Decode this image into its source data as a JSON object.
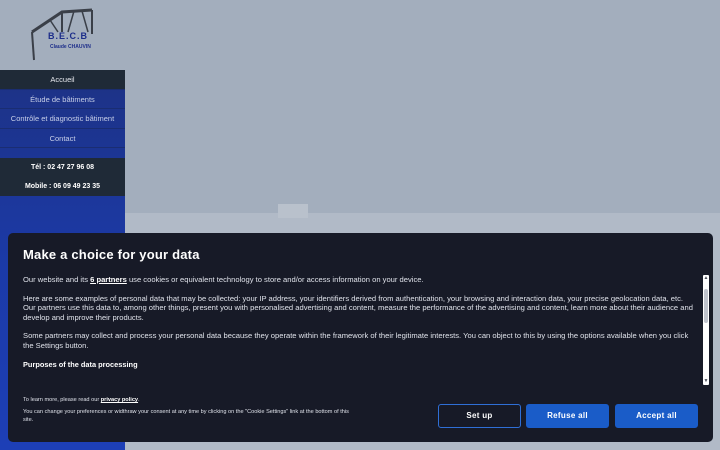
{
  "brand": {
    "logo_title": "B.E.C.B",
    "logo_subtitle": "Claude CHAUVIN"
  },
  "sidebar": {
    "menu": [
      {
        "label": "Accueil",
        "active": true
      },
      {
        "label": "Étude de bâtiments",
        "active": false
      },
      {
        "label": "Contrôle et diagnostic bâtiment",
        "active": false
      },
      {
        "label": "Contact",
        "active": false
      }
    ],
    "phones": [
      "Tél : 02 47 27 96 08",
      "Mobile : 06 09 49 23 35"
    ]
  },
  "consent": {
    "title": "Make a choice for your data",
    "intro_before": "Our website and its ",
    "partners_link": "6 partners",
    "intro_after": " use cookies or equivalent technology to store and/or access information on your device.",
    "para2": "Here are some examples of personal data that may be collected: your IP address, your identifiers derived from authentication, your browsing and interaction data, your precise geolocation data, etc.",
    "para3": "Our partners use this data to, among other things, present you with personalised advertising and content, measure the performance of the advertising and content, learn more about their audience and develop and improve their products.",
    "para4": "Some partners may collect and process your personal data because they operate within the framework of their legitimate interests. You can object to this by using the options available when you click the Settings button.",
    "purposes_heading": "Purposes of the data processing",
    "privacy_before": "To learn more, please read our ",
    "privacy_link": "privacy policy",
    "privacy_after": ".",
    "change_note": "You can change your preferences or widthraw your consent at any time by clicking on the \"Cookie Settings\" link at the bottom of this site.",
    "buttons": {
      "setup": "Set up",
      "refuse": "Refuse all",
      "accept": "Accept all"
    }
  },
  "colors": {
    "accent": "#1a5cc8",
    "modal_bg": "#171a27",
    "sidebar_dark": "#1f2a37",
    "sidebar_blue": "#1d3fb6"
  }
}
